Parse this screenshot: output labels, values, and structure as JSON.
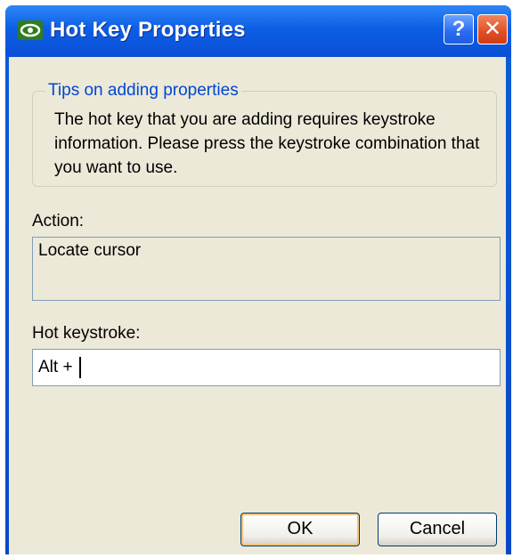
{
  "window": {
    "title": "Hot Key Properties",
    "help_glyph": "?",
    "close_glyph": "✕"
  },
  "tips": {
    "legend": "Tips on adding properties",
    "text": "The hot key that you are adding requires keystroke information. Please press the keystroke combination that you want to use."
  },
  "action": {
    "label": "Action:",
    "value": "Locate cursor"
  },
  "hotkey": {
    "label": "Hot keystroke:",
    "value": "Alt + "
  },
  "buttons": {
    "ok": "OK",
    "cancel": "Cancel"
  },
  "colors": {
    "titlebar": "#0a5ed8",
    "dialog_bg": "#ece9d8",
    "legend_text": "#0046d5",
    "close_red": "#e24e24"
  },
  "icons": {
    "app": "nvidia-logo-icon",
    "help": "help-icon",
    "close": "close-icon"
  }
}
